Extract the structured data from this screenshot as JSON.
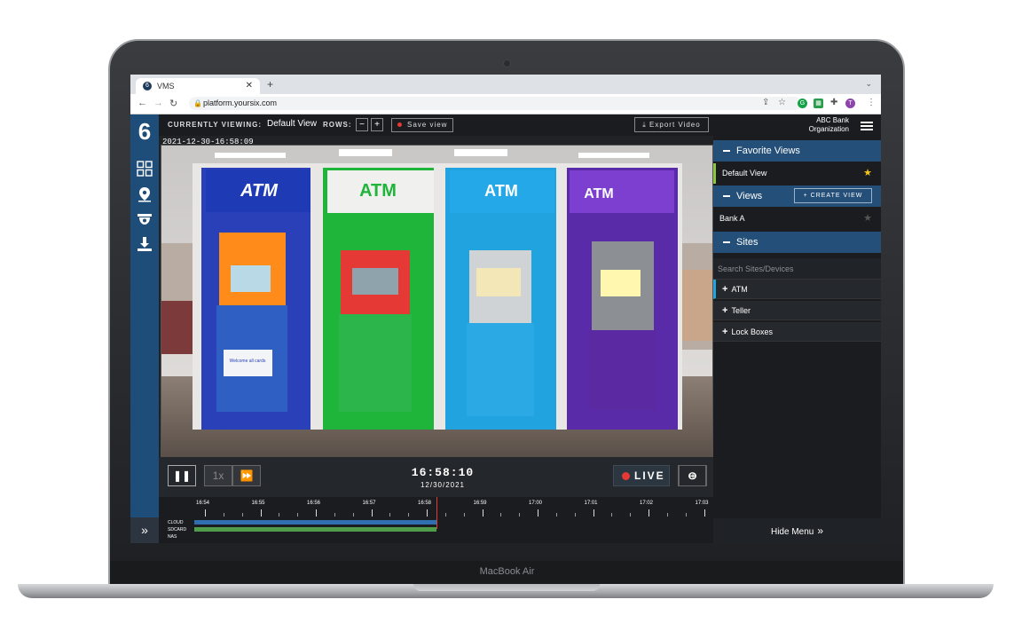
{
  "browser": {
    "tab_title": "VMS",
    "url": "platform.yoursix.com"
  },
  "toolbar": {
    "currently_viewing_label": "CURRENTLY VIEWING:",
    "current_view": "Default View",
    "rows_label": "ROWS:",
    "rows_minus": "−",
    "rows_plus": "+",
    "save_view_label": "Save view",
    "export_video_label": "Export Video"
  },
  "organization": {
    "name": "ABC Bank",
    "type": "Organization"
  },
  "video": {
    "timestamp": "2021-12-30-16:58:09",
    "atm_signs": [
      "ATM",
      "ATM",
      "ATM",
      "ATM"
    ],
    "atm_colors": [
      "#ff8c1a",
      "#2eaa3e",
      "#1fa6de",
      "#5b2aa3"
    ],
    "sticker_text": "Welcome all cards"
  },
  "playback": {
    "pause_icon": "pause-icon",
    "speed_label": "1x",
    "time": "16:58:10",
    "date": "12/30/2021",
    "live_label": "LIVE",
    "zoom_in_icon": "zoom-in-icon",
    "zoom_out_icon": "zoom-out-icon"
  },
  "timeline": {
    "labels": [
      "16:54",
      "16:55",
      "16:56",
      "16:57",
      "16:58",
      "16:59",
      "17:00",
      "17:01",
      "17:02",
      "17:03"
    ],
    "tracks": [
      "CLOUD",
      "SDCARD",
      "NAS"
    ],
    "track_colors": [
      "#2f6fb0",
      "#4f9c4a",
      "#333333"
    ]
  },
  "sidebar": {
    "favorite_views_title": "Favorite Views",
    "favorite_views": [
      "Default View"
    ],
    "views_title": "Views",
    "create_view_label": "+ CREATE VIEW",
    "views": [
      "Bank A"
    ],
    "sites_title": "Sites",
    "search_placeholder": "Search Sites/Devices",
    "sites": [
      "ATM",
      "Teller",
      "Lock Boxes"
    ],
    "hide_menu_label": "Hide Menu"
  },
  "device": {
    "model": "MacBook Air"
  },
  "colors": {
    "brand": "#1f4d7a",
    "accent_live": "#e53935",
    "star_active": "#f5c518",
    "favorite_marker": "#8dc63f"
  }
}
